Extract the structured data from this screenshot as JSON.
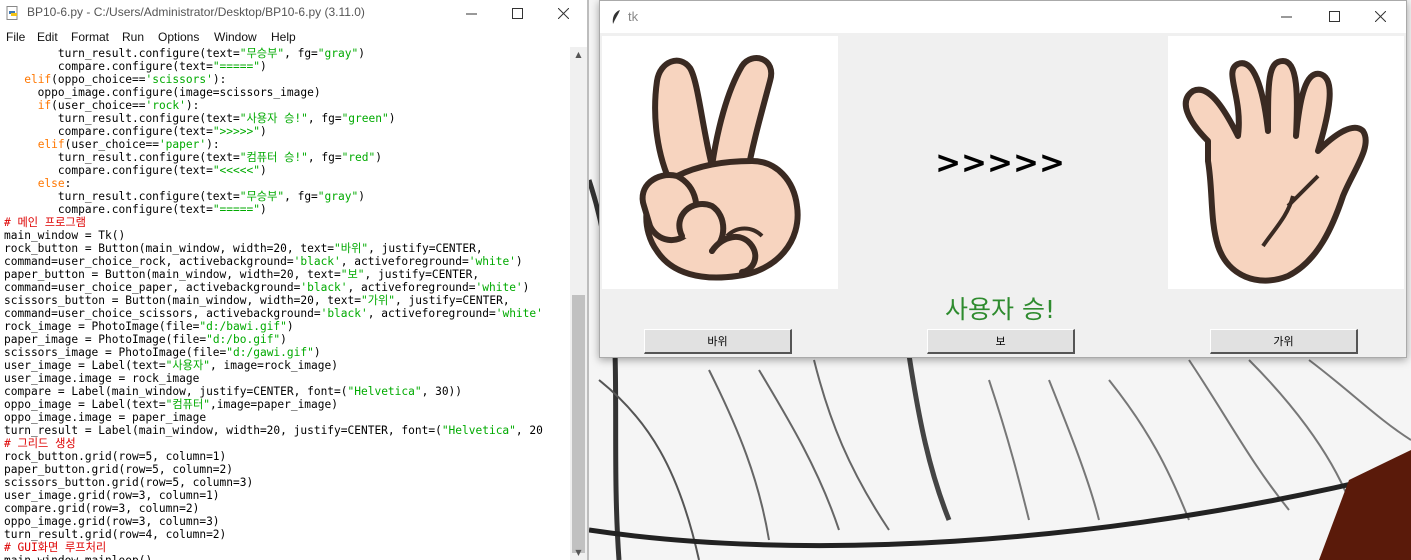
{
  "idle": {
    "title": "BP10-6.py - C:/Users/Administrator/Desktop/BP10-6.py (3.11.0)",
    "menu": [
      "File",
      "Edit",
      "Format",
      "Run",
      "Options",
      "Window",
      "Help"
    ]
  },
  "code_lines": [
    [
      [
        "t",
        "        turn_result.configure(text="
      ],
      [
        "s",
        "\"무승부\""
      ],
      [
        "t",
        ", fg="
      ],
      [
        "s",
        "\"gray\""
      ],
      [
        "t",
        ")"
      ]
    ],
    [
      [
        "t",
        "        compare.configure(text="
      ],
      [
        "s",
        "\"=====\""
      ],
      [
        "t",
        ")"
      ]
    ],
    [
      [
        "t",
        "   "
      ],
      [
        "k",
        "elif"
      ],
      [
        "t",
        "(oppo_choice=="
      ],
      [
        "s",
        "'scissors'"
      ],
      [
        "t",
        "):"
      ]
    ],
    [
      [
        "t",
        "     oppo_image.configure(image=scissors_image)"
      ]
    ],
    [
      [
        "t",
        "     "
      ],
      [
        "k",
        "if"
      ],
      [
        "t",
        "(user_choice=="
      ],
      [
        "s",
        "'rock'"
      ],
      [
        "t",
        "):"
      ]
    ],
    [
      [
        "t",
        "        turn_result.configure(text="
      ],
      [
        "s",
        "\"사용자 승!\""
      ],
      [
        "t",
        ", fg="
      ],
      [
        "s",
        "\"green\""
      ],
      [
        "t",
        ")"
      ]
    ],
    [
      [
        "t",
        "        compare.configure(text="
      ],
      [
        "s",
        "\">>>>>\""
      ],
      [
        "t",
        ")"
      ]
    ],
    [
      [
        "t",
        "     "
      ],
      [
        "k",
        "elif"
      ],
      [
        "t",
        "(user_choice=="
      ],
      [
        "s",
        "'paper'"
      ],
      [
        "t",
        "):"
      ]
    ],
    [
      [
        "t",
        "        turn_result.configure(text="
      ],
      [
        "s",
        "\"컴퓨터 승!\""
      ],
      [
        "t",
        ", fg="
      ],
      [
        "s",
        "\"red\""
      ],
      [
        "t",
        ")"
      ]
    ],
    [
      [
        "t",
        "        compare.configure(text="
      ],
      [
        "s",
        "\"<<<<<\""
      ],
      [
        "t",
        ")"
      ]
    ],
    [
      [
        "t",
        "     "
      ],
      [
        "k",
        "else"
      ],
      [
        "t",
        ":"
      ]
    ],
    [
      [
        "t",
        "        turn_result.configure(text="
      ],
      [
        "s",
        "\"무승부\""
      ],
      [
        "t",
        ", fg="
      ],
      [
        "s",
        "\"gray\""
      ],
      [
        "t",
        ")"
      ]
    ],
    [
      [
        "t",
        "        compare.configure(text="
      ],
      [
        "s",
        "\"=====\""
      ],
      [
        "t",
        ")"
      ]
    ],
    [
      [
        "c",
        "# 메인 프로그램"
      ]
    ],
    [
      [
        "t",
        "main_window = Tk()"
      ]
    ],
    [
      [
        "t",
        "rock_button = Button(main_window, width=20, text="
      ],
      [
        "s",
        "\"바위\""
      ],
      [
        "t",
        ", justify=CENTER,"
      ]
    ],
    [
      [
        "t",
        "command=user_choice_rock, activebackground="
      ],
      [
        "s",
        "'black'"
      ],
      [
        "t",
        ", activeforeground="
      ],
      [
        "s",
        "'white'"
      ],
      [
        "t",
        ")"
      ]
    ],
    [
      [
        "t",
        "paper_button = Button(main_window, width=20, text="
      ],
      [
        "s",
        "\"보\""
      ],
      [
        "t",
        ", justify=CENTER,"
      ]
    ],
    [
      [
        "t",
        "command=user_choice_paper, activebackground="
      ],
      [
        "s",
        "'black'"
      ],
      [
        "t",
        ", activeforeground="
      ],
      [
        "s",
        "'white'"
      ],
      [
        "t",
        ")"
      ]
    ],
    [
      [
        "t",
        "scissors_button = Button(main_window, width=20, text="
      ],
      [
        "s",
        "\"가위\""
      ],
      [
        "t",
        ", justify=CENTER,"
      ]
    ],
    [
      [
        "t",
        "command=user_choice_scissors, activebackground="
      ],
      [
        "s",
        "'black'"
      ],
      [
        "t",
        ", activeforeground="
      ],
      [
        "s",
        "'white'"
      ]
    ],
    [
      [
        "t",
        "rock_image = PhotoImage(file="
      ],
      [
        "s",
        "\"d:/bawi.gif\""
      ],
      [
        "t",
        ")"
      ]
    ],
    [
      [
        "t",
        "paper_image = PhotoImage(file="
      ],
      [
        "s",
        "\"d:/bo.gif\""
      ],
      [
        "t",
        ")"
      ]
    ],
    [
      [
        "t",
        "scissors_image = PhotoImage(file="
      ],
      [
        "s",
        "\"d:/gawi.gif\""
      ],
      [
        "t",
        ")"
      ]
    ],
    [
      [
        "t",
        "user_image = Label(text="
      ],
      [
        "s",
        "\"사용자\""
      ],
      [
        "t",
        ", image=rock_image)"
      ]
    ],
    [
      [
        "t",
        "user_image.image = rock_image"
      ]
    ],
    [
      [
        "t",
        "compare = Label(main_window, justify=CENTER, font=("
      ],
      [
        "s",
        "\"Helvetica\""
      ],
      [
        "t",
        ", 30))"
      ]
    ],
    [
      [
        "t",
        "oppo_image = Label(text="
      ],
      [
        "s",
        "\"컴퓨터\""
      ],
      [
        "t",
        ",image=paper_image)"
      ]
    ],
    [
      [
        "t",
        "oppo_image.image = paper_image"
      ]
    ],
    [
      [
        "t",
        "turn_result = Label(main_window, width=20, justify=CENTER, font=("
      ],
      [
        "s",
        "\"Helvetica\""
      ],
      [
        "t",
        ", 20"
      ]
    ],
    [
      [
        "c",
        "# 그리드 생성"
      ]
    ],
    [
      [
        "t",
        "rock_button.grid(row=5, column=1)"
      ]
    ],
    [
      [
        "t",
        "paper_button.grid(row=5, column=2)"
      ]
    ],
    [
      [
        "t",
        "scissors_button.grid(row=5, column=3)"
      ]
    ],
    [
      [
        "t",
        "user_image.grid(row=3, column=1)"
      ]
    ],
    [
      [
        "t",
        "compare.grid(row=3, column=2)"
      ]
    ],
    [
      [
        "t",
        "oppo_image.grid(row=3, column=3)"
      ]
    ],
    [
      [
        "t",
        "turn_result.grid(row=4, column=2)"
      ]
    ],
    [
      [
        "c",
        "# GUI화면 루프처리"
      ]
    ],
    [
      [
        "t",
        "main_window.mainloop()"
      ]
    ]
  ],
  "tk": {
    "title": "tk",
    "compare_text": ">>>>>",
    "result_text": "사용자 승!",
    "result_color": "#2e8b2e",
    "user_image": "peace-sign-hand-icon",
    "oppo_image": "open-hand-icon",
    "buttons": [
      "바위",
      "보",
      "가위"
    ]
  },
  "colors": {
    "keyword": "#ff7700",
    "string": "#00aa00",
    "comment": "#dd0000"
  }
}
